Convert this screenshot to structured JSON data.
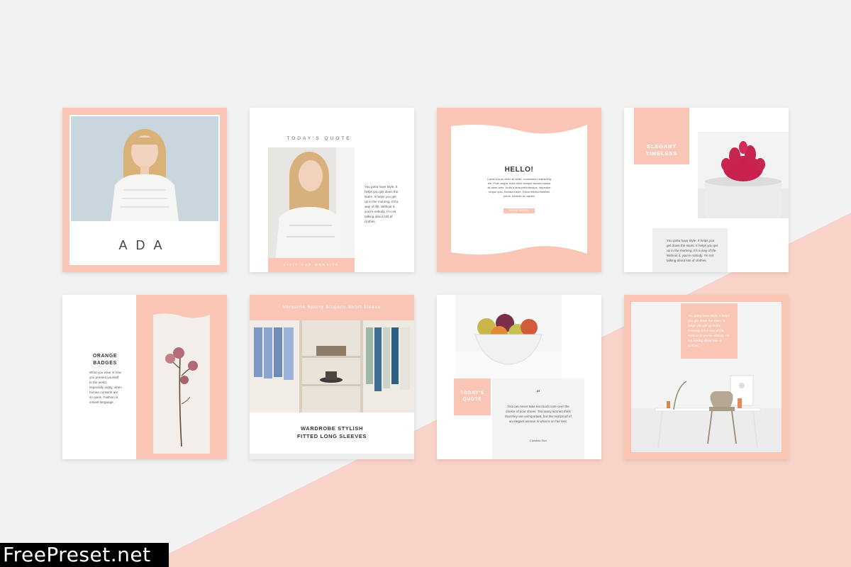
{
  "colors": {
    "peach": "#f9c5b5",
    "background": "#f2f2f3",
    "accent_text": "#333333"
  },
  "cards": {
    "ada": {
      "name": "ADA"
    },
    "quote": {
      "heading": "TODAY'S QUOTE",
      "body": "You gotta have style. It helps you get down the stairs. It helps you get up in the morning. It's a way of life. Without it, you're nobody. I'm not talking about lots of clothes.",
      "button": "VISIT OUR WEBSITE"
    },
    "hello": {
      "heading": "HELLO!",
      "body": "Lorem ipsum dolor sit amet, consectetur adipiscing elit. Proin augue nulla dolor semper lacinia massa sit amet ante. Nulla a ante pellentesque, imperdiet neque quis, tincidunt ante. Etiam efficitur facilisis purus. Aenean eu sapien",
      "button": "READ MORE"
    },
    "elegant": {
      "heading": "ELEGANT TIMELESS",
      "body": "You gotta have style. It helps you get down the stairs. It helps you get up in the morning. It's a way of life. Without it, you're nobody. I'm not talking about lots of clothes."
    },
    "orange": {
      "heading": "ORANGE BADGES",
      "body": "What you wear is how you present yourself to the world, especially today, when human contacts are so quick. Fashion is instant language."
    },
    "wardrobe": {
      "banner": "Versatile Sporty Slogans Short Sleeve",
      "title_line1": "WARDROBE STYLISH",
      "title_line2": "FITTED LONG SLEEVES"
    },
    "fruit": {
      "label": "TODAY'S QUOTE",
      "quote_mark": "“",
      "quote": "You can never take too much care over the choice of your shoes. Too many women think that they are unimportant, but the real proof of an elegant woman is what is on her feet.",
      "author": "Christian Dior"
    },
    "desk": {
      "body": "You gotta have style. It helps you get down the stairs. It helps you get up in the morning. It's a way of life. Without it, you're nobody. I'm not talking about lots of clothes."
    }
  },
  "watermark": "FreePreset.net"
}
